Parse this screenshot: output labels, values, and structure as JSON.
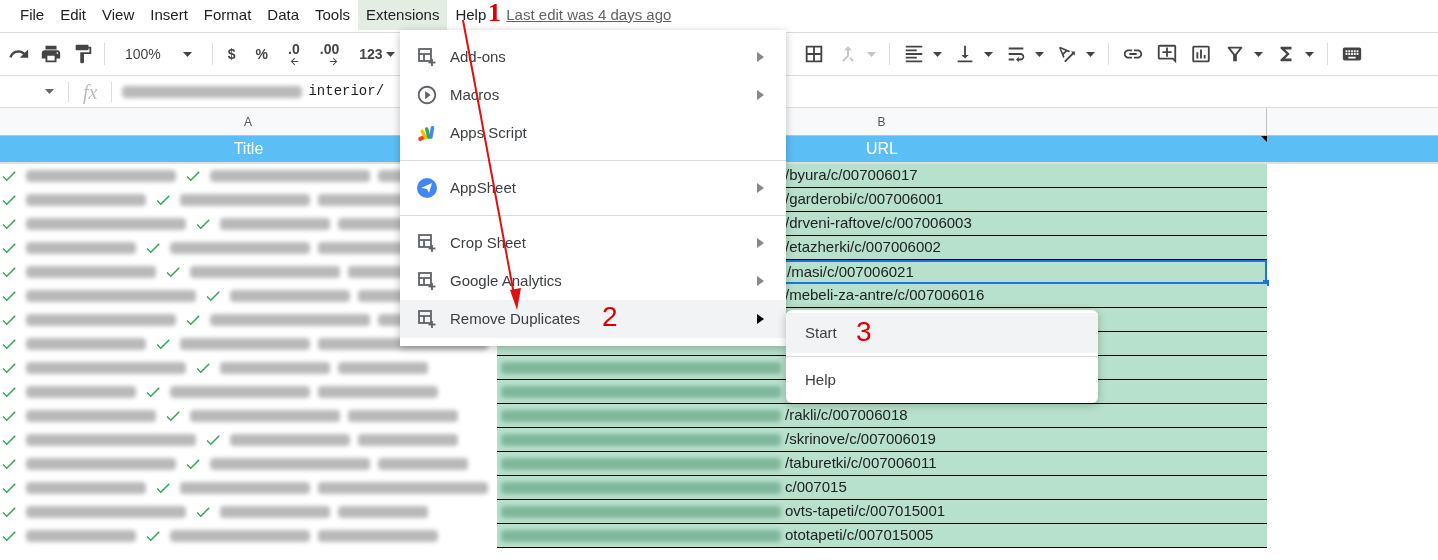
{
  "menu_bar": {
    "items": [
      {
        "label": "File",
        "selected": false
      },
      {
        "label": "Edit",
        "selected": false
      },
      {
        "label": "View",
        "selected": false
      },
      {
        "label": "Insert",
        "selected": false
      },
      {
        "label": "Format",
        "selected": false
      },
      {
        "label": "Data",
        "selected": false
      },
      {
        "label": "Tools",
        "selected": false
      },
      {
        "label": "Extensions",
        "selected": true
      },
      {
        "label": "Help",
        "selected": false
      }
    ],
    "last_edit": "Last edit was 4 days ago"
  },
  "toolbar": {
    "zoom": "100%",
    "format_buttons": [
      "$",
      "%",
      ".0",
      ".00",
      "123"
    ],
    "icon_buttons": [
      {
        "kind": "borders",
        "disabled": false
      },
      {
        "kind": "merge",
        "disabled": true
      },
      {
        "kind": "align",
        "disabled": false
      },
      {
        "kind": "valign",
        "disabled": false
      },
      {
        "kind": "wrap",
        "disabled": false
      },
      {
        "kind": "rotate",
        "disabled": false
      },
      {
        "kind": "link",
        "disabled": false
      },
      {
        "kind": "comment",
        "disabled": false
      },
      {
        "kind": "chart",
        "disabled": false
      },
      {
        "kind": "filter",
        "disabled": false
      },
      {
        "kind": "functions",
        "disabled": false
      },
      {
        "kind": "keyboard",
        "disabled": false
      }
    ]
  },
  "formula_bar": {
    "fx": "fx",
    "value": "interior/"
  },
  "sheet": {
    "columns": [
      "A",
      "B"
    ],
    "header": [
      "Title",
      "URL"
    ],
    "rows": [
      {
        "url": "/byura/c/007006017",
        "selected": false
      },
      {
        "url": "/garderobi/c/007006001",
        "selected": false
      },
      {
        "url": "/drveni-raftove/c/007006003",
        "selected": false
      },
      {
        "url": "/etazherki/c/007006002",
        "selected": false
      },
      {
        "url": "/masi/c/007006021",
        "selected": true
      },
      {
        "url": "/mebeli-za-antre/c/007006016",
        "selected": false
      },
      {
        "selected": false
      },
      {
        "selected": false
      },
      {
        "selected": false,
        "blurred_prefix": true
      },
      {
        "selected": false,
        "blurred_prefix": true
      },
      {
        "url": "/rakli/c/007006018",
        "selected": false,
        "blurred_prefix": true
      },
      {
        "url": "/skrinove/c/007006019",
        "selected": false,
        "blurred_prefix": true
      },
      {
        "url": "/taburetki/c/007006011",
        "selected": false,
        "blurred_prefix": true
      },
      {
        "url": "c/007015",
        "selected": false,
        "blurred_prefix": true
      },
      {
        "url": "ovts-tapeti/c/007015001",
        "selected": false,
        "blurred_prefix": true
      },
      {
        "url": "ototapeti/c/007015005",
        "selected": false,
        "blurred_prefix": true
      }
    ]
  },
  "extensions_menu": {
    "groups": [
      [
        {
          "label": "Add-ons",
          "kind": "addon",
          "submenu": true,
          "selected": false
        },
        {
          "label": "Macros",
          "kind": "play",
          "submenu": true,
          "selected": false
        },
        {
          "label": "Apps Script",
          "kind": "script",
          "submenu": false,
          "selected": false
        }
      ],
      [
        {
          "label": "AppSheet",
          "kind": "appsheet",
          "submenu": true,
          "selected": false
        }
      ],
      [
        {
          "label": "Crop Sheet",
          "kind": "addon",
          "submenu": true,
          "selected": false
        },
        {
          "label": "Google Analytics",
          "kind": "addon",
          "submenu": true,
          "selected": false
        },
        {
          "label": "Remove Duplicates",
          "kind": "addon",
          "submenu": true,
          "selected": true
        }
      ]
    ]
  },
  "submenu": {
    "items": [
      {
        "label": "Start",
        "selected": true
      },
      {
        "label": "Help",
        "selected": false
      }
    ]
  },
  "annotations": [
    "1",
    "2",
    "3"
  ]
}
